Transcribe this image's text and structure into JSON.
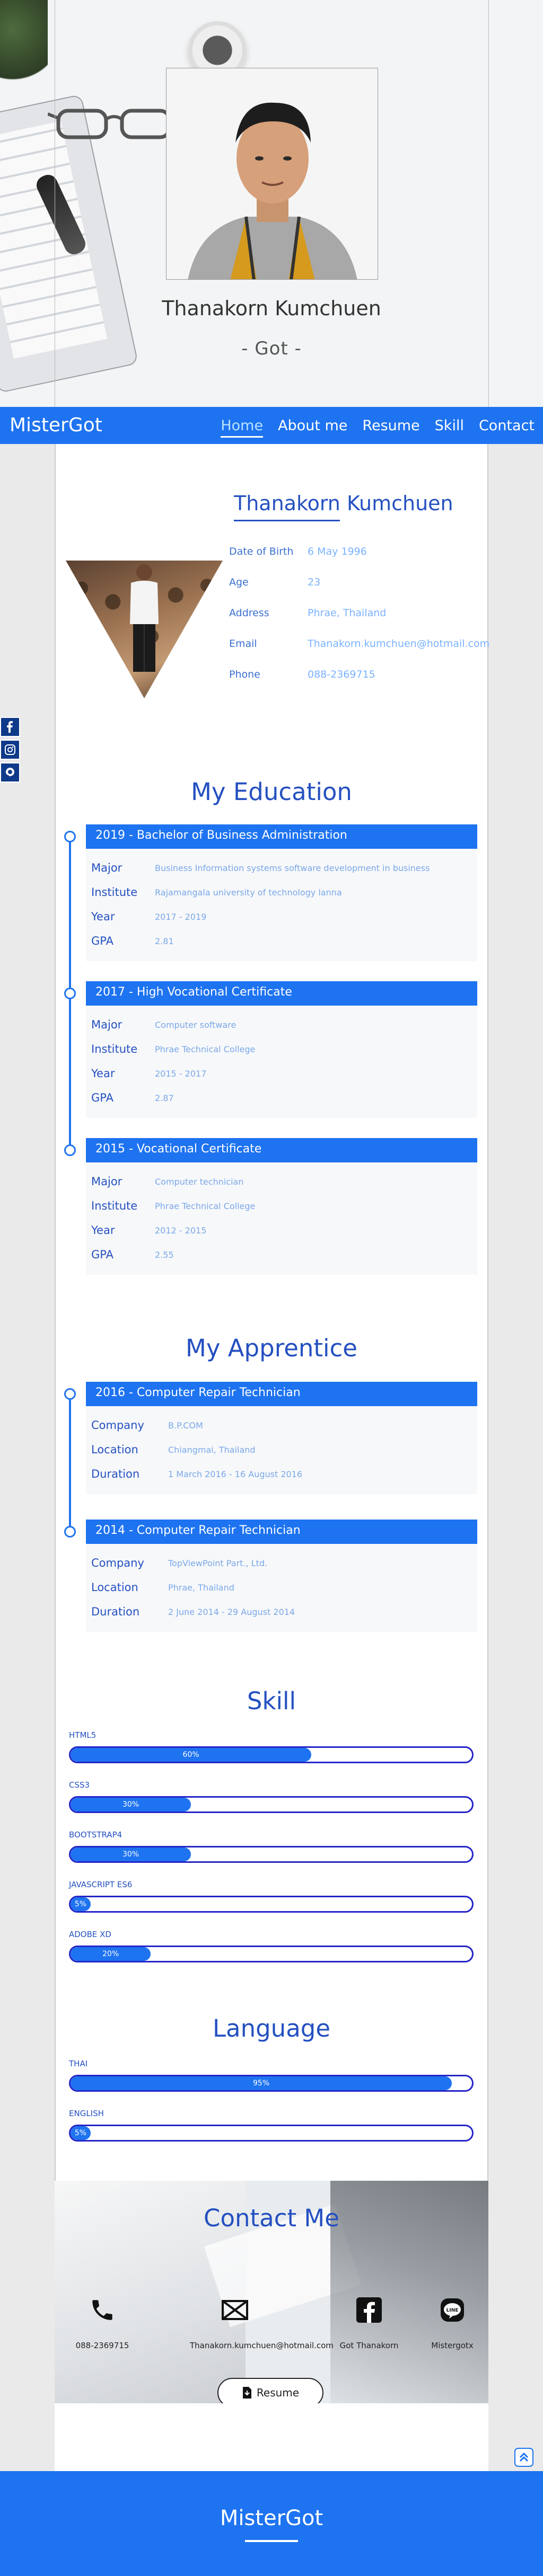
{
  "hero": {
    "name": "Thanakorn Kumchuen",
    "nickname": "- Got -"
  },
  "nav": {
    "brand": "MisterGot",
    "links": [
      "Home",
      "About me",
      "Resume",
      "Skill",
      "Contact"
    ],
    "active": "Home"
  },
  "profile": {
    "name": "Thanakorn Kumchuen",
    "fields": [
      {
        "label": "Date of Birth",
        "value": "6 May 1996"
      },
      {
        "label": "Age",
        "value": "23"
      },
      {
        "label": "Address",
        "value": "Phrae, Thailand"
      },
      {
        "label": "Email",
        "value": "Thanakorn.kumchuen@hotmail.com"
      },
      {
        "label": "Phone",
        "value": "088-2369715"
      }
    ]
  },
  "education": {
    "title": "My Education",
    "items": [
      {
        "heading": "2019 - Bachelor of Business Administration",
        "rows": [
          {
            "label": "Major",
            "value": "Business Information systems software development in business"
          },
          {
            "label": "Institute",
            "value": "Rajamangala university of technology lanna"
          },
          {
            "label": "Year",
            "value": "2017 - 2019"
          },
          {
            "label": "GPA",
            "value": "2.81"
          }
        ]
      },
      {
        "heading": "2017 - High Vocational Certificate",
        "rows": [
          {
            "label": "Major",
            "value": "Computer software"
          },
          {
            "label": "Institute",
            "value": "Phrae Technical College"
          },
          {
            "label": "Year",
            "value": "2015 - 2017"
          },
          {
            "label": "GPA",
            "value": "2.87"
          }
        ]
      },
      {
        "heading": "2015 - Vocational Certificate",
        "rows": [
          {
            "label": "Major",
            "value": "Computer technician"
          },
          {
            "label": "Institute",
            "value": "Phrae Technical College"
          },
          {
            "label": "Year",
            "value": "2012 - 2015"
          },
          {
            "label": "GPA",
            "value": "2.55"
          }
        ]
      }
    ]
  },
  "apprentice": {
    "title": "My Apprentice",
    "items": [
      {
        "heading": "2016 - Computer Repair Technician",
        "rows": [
          {
            "label": "Company",
            "value": "B.P.COM"
          },
          {
            "label": "Location",
            "value": "Chiangmai, Thailand"
          },
          {
            "label": "Duration",
            "value": "1 March 2016 - 16 August 2016"
          }
        ]
      },
      {
        "heading": "2014 - Computer Repair Technician",
        "rows": [
          {
            "label": "Company",
            "value": "TopViewPoint Part., Ltd."
          },
          {
            "label": "Location",
            "value": "Phrae, Thailand"
          },
          {
            "label": "Duration",
            "value": "2 June 2014 - 29 August 2014"
          }
        ]
      }
    ]
  },
  "skill": {
    "title": "Skill",
    "bars": [
      {
        "name": "HTML5",
        "value": 60,
        "label": "60%"
      },
      {
        "name": "CSS3",
        "value": 30,
        "label": "30%"
      },
      {
        "name": "BOOTSTRAP4",
        "value": 30,
        "label": "30%"
      },
      {
        "name": "JAVASCRIPT ES6",
        "value": 5,
        "label": "5%"
      },
      {
        "name": "ADOBE XD",
        "value": 20,
        "label": "20%"
      }
    ]
  },
  "language": {
    "title": "Language",
    "bars": [
      {
        "name": "THAI",
        "value": 95,
        "label": "95%"
      },
      {
        "name": "ENGLISH",
        "value": 5,
        "label": "5%"
      }
    ]
  },
  "contact": {
    "title": "Contact Me",
    "items": [
      {
        "icon": "phone-icon",
        "text": "088-2369715"
      },
      {
        "icon": "mail-icon",
        "text": "Thanakorn.kumchuen@hotmail.com"
      },
      {
        "icon": "facebook-icon",
        "text": "Got Thanakorn"
      },
      {
        "icon": "line-icon",
        "text": "Mistergotx"
      }
    ],
    "resume_button": "Resume"
  },
  "footer": {
    "brand": "MisterGot"
  },
  "colors": {
    "primary": "#1e73f0",
    "heading": "#2450c0",
    "bar_border": "#2525c8"
  }
}
